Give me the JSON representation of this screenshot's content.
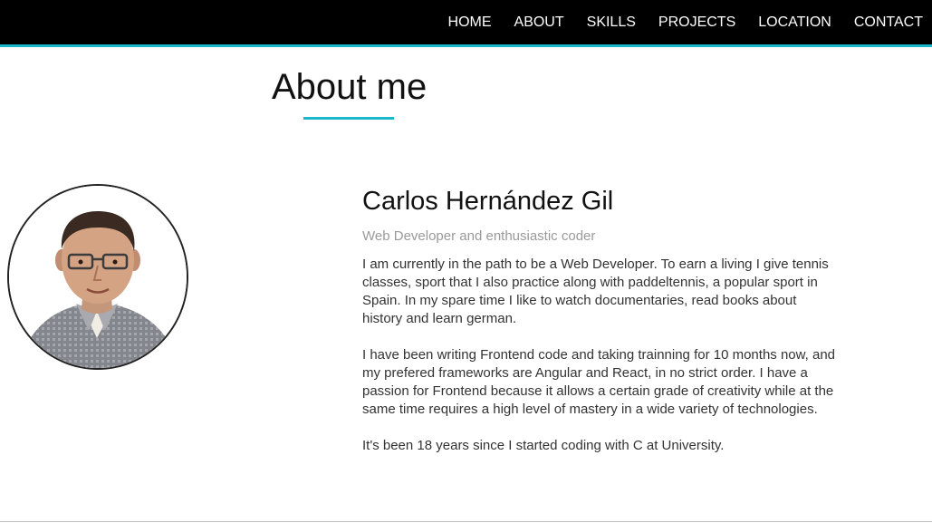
{
  "nav": {
    "items": [
      "HOME",
      "ABOUT",
      "SKILLS",
      "PROJECTS",
      "LOCATION",
      "CONTACT"
    ]
  },
  "about": {
    "title": "About me",
    "name": "Carlos Hernández Gil",
    "tagline": "Web Developer and enthusiastic coder",
    "paragraphs": [
      "I am currently in the path to be a Web Developer. To earn a living I give tennis classes, sport that I also practice along with paddeltennis, a popular sport in Spain. In my spare time I like to watch documentaries, read books about history and learn german.",
      "I have been writing Frontend code and taking trainning for 10 months now, and my prefered frameworks are Angular and React, in no strict order. I have a passion for Frontend because it allows a certain grade of creativity while at the same time requires a high level of mastery in a wide variety of technologies.",
      "It's been 18 years since I started coding with C at University."
    ]
  },
  "colors": {
    "accent": "#1bb8c9",
    "navbar": "#000000"
  }
}
